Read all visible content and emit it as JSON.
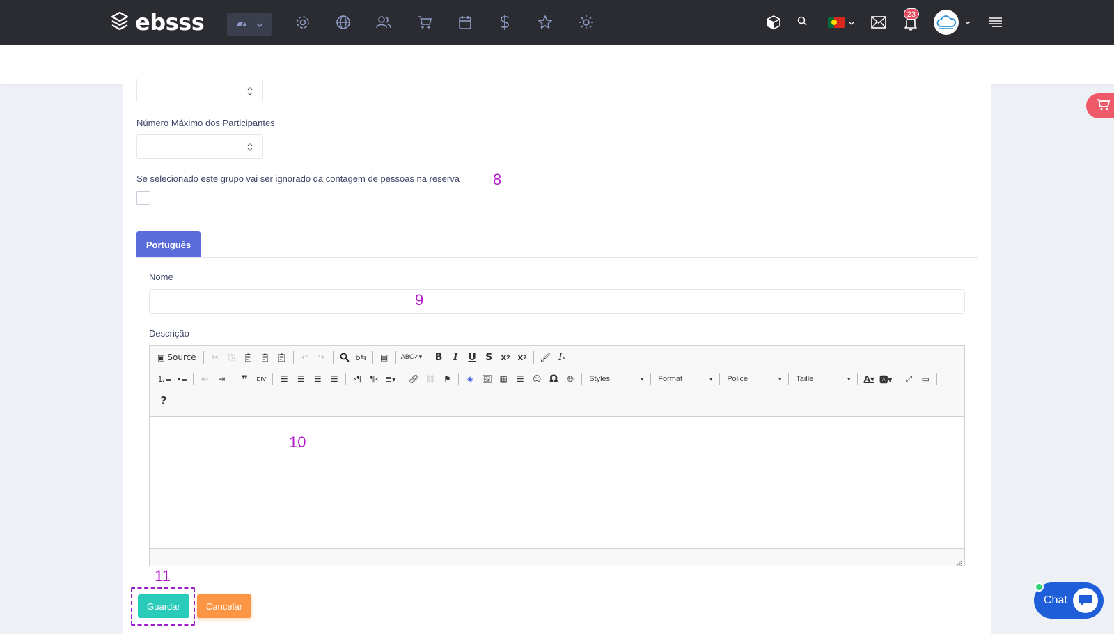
{
  "app": {
    "logo_text": "ebsss"
  },
  "nav": {
    "icons": [
      "gear-icon",
      "globe-icon",
      "users-icon",
      "cart-icon",
      "calendar-icon",
      "dollar-icon",
      "star-icon",
      "sun-icon"
    ],
    "notification_count": "23",
    "language_flag": "portugal-flag-icon"
  },
  "form": {
    "max_participants_label": "Número Máximo dos Participantes",
    "ignore_group_label": "Se selecionado este grupo vai ser ignorado da contagem de pessoas na reserva",
    "tab_label": "Português",
    "name_label": "Nome",
    "description_label": "Descrição"
  },
  "editor": {
    "source_label": "Source",
    "styles_label": "Styles",
    "format_label": "Format",
    "font_label": "Police",
    "size_label": "Taille",
    "help_label": "?"
  },
  "annotations": {
    "a8": "8",
    "a9": "9",
    "a10": "10",
    "a11": "11"
  },
  "actions": {
    "save_label": "Guardar",
    "cancel_label": "Cancelar"
  },
  "chat": {
    "label": "Chat"
  },
  "colors": {
    "primary": "#5a6cd9",
    "save": "#2bcbba",
    "cancel": "#fd9644",
    "annotation": "#b21cc9",
    "topbar": "#2b2c31"
  }
}
